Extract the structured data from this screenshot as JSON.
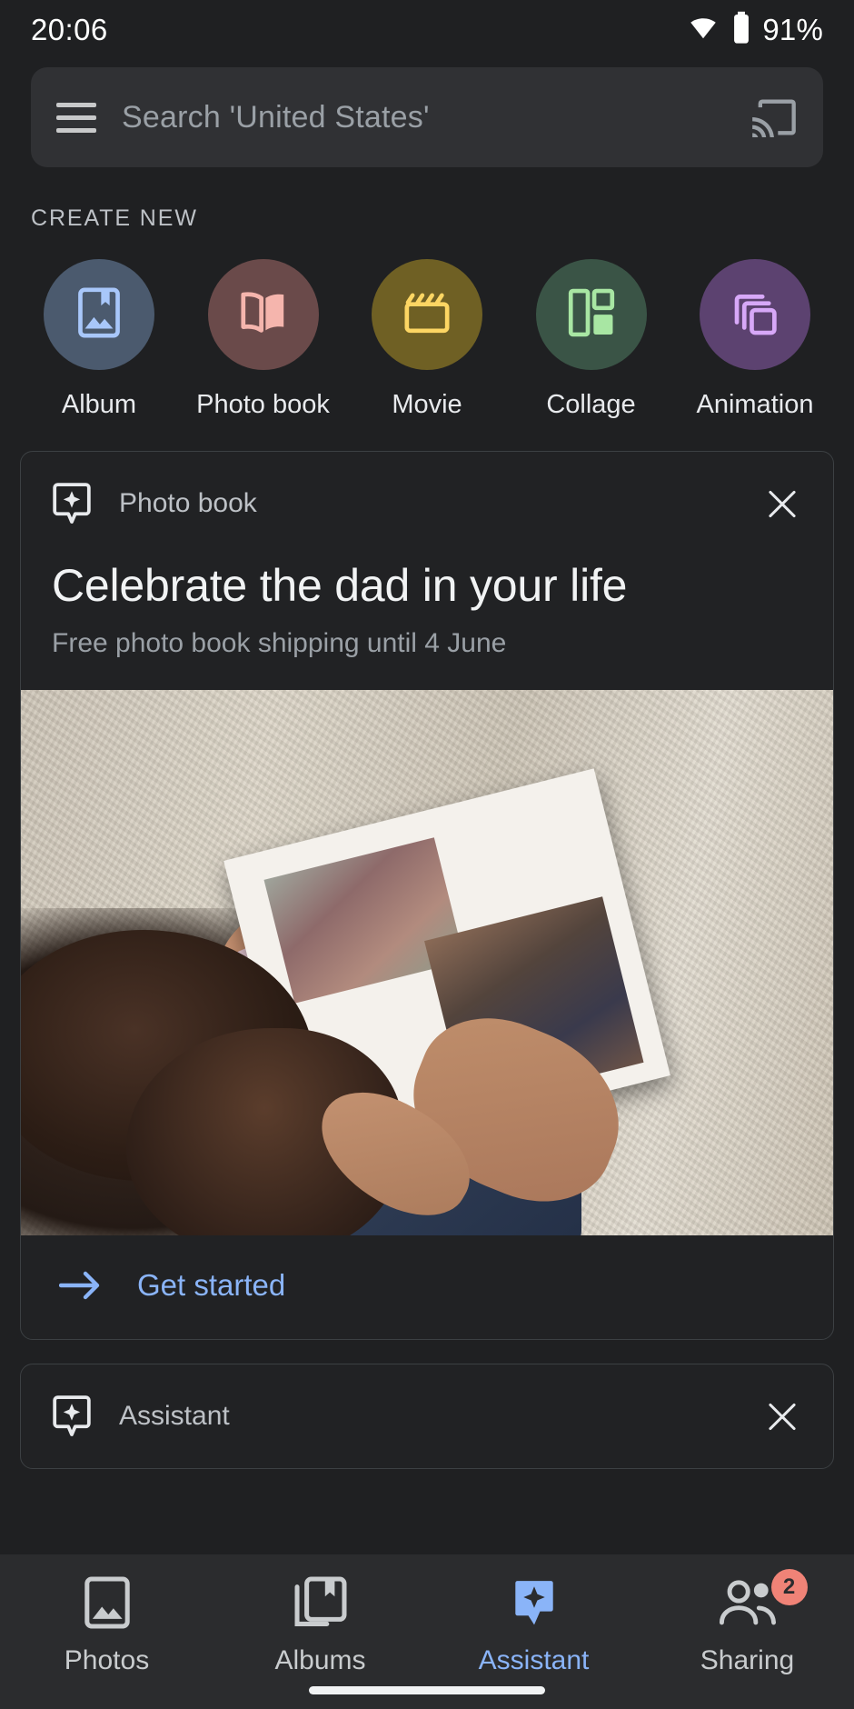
{
  "status_bar": {
    "time": "20:06",
    "battery_percent": "91%",
    "wifi_icon": "wifi-icon",
    "battery_icon": "battery-icon"
  },
  "search": {
    "menu_icon": "hamburger-menu-icon",
    "placeholder": "Search 'United States'",
    "cast_icon": "cast-icon"
  },
  "create_new": {
    "section_title": "CREATE NEW",
    "items": [
      {
        "label": "Album",
        "icon": "album-icon",
        "circle_color": "#4b5a6e",
        "icon_color": "#a8c7fa"
      },
      {
        "label": "Photo book",
        "icon": "book-icon",
        "circle_color": "#6a4a4a",
        "icon_color": "#f5b5ad"
      },
      {
        "label": "Movie",
        "icon": "clapperboard-icon",
        "circle_color": "#6f6024",
        "icon_color": "#fdd663"
      },
      {
        "label": "Collage",
        "icon": "collage-icon",
        "circle_color": "#3a5446",
        "icon_color": "#a8e6a3"
      },
      {
        "label": "Animation",
        "icon": "layers-icon",
        "circle_color": "#5c4270",
        "icon_color": "#d7a8f8"
      }
    ]
  },
  "cards": [
    {
      "badge_icon": "assistant-card-icon",
      "kind": "Photo book",
      "close_icon": "close-icon",
      "title": "Celebrate the dad in your life",
      "subtitle": "Free photo book shipping until 4 June",
      "photo_alt": "Family looking at a printed photo book on a knitted blanket",
      "cta_icon": "arrow-right-icon",
      "cta_label": "Get started",
      "cta_color": "#8ab4f8"
    },
    {
      "badge_icon": "assistant-card-icon",
      "kind": "Assistant",
      "close_icon": "close-icon"
    }
  ],
  "bottom_nav": {
    "items": [
      {
        "label": "Photos",
        "icon": "photo-icon",
        "active": "false",
        "badge": ""
      },
      {
        "label": "Albums",
        "icon": "albums-icon",
        "active": "false",
        "badge": ""
      },
      {
        "label": "Assistant",
        "icon": "assistant-icon",
        "active": "true",
        "badge": ""
      },
      {
        "label": "Sharing",
        "icon": "people-icon",
        "active": "false",
        "badge": "2"
      }
    ],
    "active_color": "#8ab4f8",
    "badge_color": "#f08377"
  },
  "home_indicator": "home-indicator"
}
